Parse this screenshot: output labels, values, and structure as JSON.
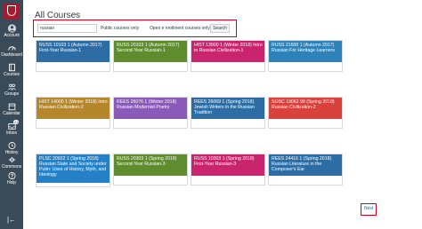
{
  "sidebar": {
    "items": [
      {
        "label": "Account",
        "icon": "user-icon"
      },
      {
        "label": "Dashboard",
        "icon": "dashboard-icon"
      },
      {
        "label": "Courses",
        "icon": "book-icon"
      },
      {
        "label": "Groups",
        "icon": "groups-icon"
      },
      {
        "label": "Calendar",
        "icon": "calendar-icon"
      },
      {
        "label": "Inbox",
        "icon": "inbox-icon",
        "badge": "21"
      },
      {
        "label": "History",
        "icon": "clock-icon"
      },
      {
        "label": "Commons",
        "icon": "commons-icon"
      },
      {
        "label": "Help",
        "icon": "help-icon"
      }
    ]
  },
  "page": {
    "title": "All Courses"
  },
  "filters": {
    "search_value": "russian",
    "public_label": "Public courses only",
    "open_enroll_label": "Open e nrollment courses only",
    "search_button": "Search"
  },
  "courses": [
    {
      "title": "RUSS 10103 1 (Autumn 2017) First-Year Russian-1",
      "color": "#2e6da4"
    },
    {
      "title": "RUSS 20103 1 (Autumn 2017) Second-Year Russian-1",
      "color": "#5e8c2f"
    },
    {
      "title": "HIST 13900 1 (Winter 2018) Intro to Russian Civilization-1",
      "color": "#c9256f"
    },
    {
      "title": "RUSS 21600 1 (Autumn 2017) Russian For Heritage Learners",
      "color": "#2e82b8"
    },
    {
      "title": "HIST 14000 1 (Winter 2018) Intro Russian Civilization-2",
      "color": "#b5862b"
    },
    {
      "title": "REES 26076 1 (Winter 2018) Russian Modernist Poetry",
      "color": "#8a5ab8"
    },
    {
      "title": "REES 26069 1 (Spring 2018) Jewish Writers in the Russian Tradition",
      "color": "#2e6da4"
    },
    {
      "title": "SOSC 19062 99 (Spring 2018) Russian Civilization-2",
      "color": "#d8413c"
    },
    {
      "title": "PLSC 20922 1 (Spring 2018) Russian State and Society under Putin: Uses of History, Myth, and Ideology",
      "color": "#2680c6"
    },
    {
      "title": "RUSS 20303 1 (Spring 2018) Second-Year Russian-3",
      "color": "#5e8c2f"
    },
    {
      "title": "RUSS 10303 1 (Spring 2018) First-Year Russian-3",
      "color": "#c9256f"
    },
    {
      "title": "REES 24416 1 (Spring 2018) Russian Literature in the Composer's Ear",
      "color": "#2e6da4"
    }
  ],
  "pagination": {
    "next_label": "Next"
  },
  "colors": {
    "sidebar": "#394b58",
    "highlight": "#d0021b",
    "link": "#0770a3"
  }
}
